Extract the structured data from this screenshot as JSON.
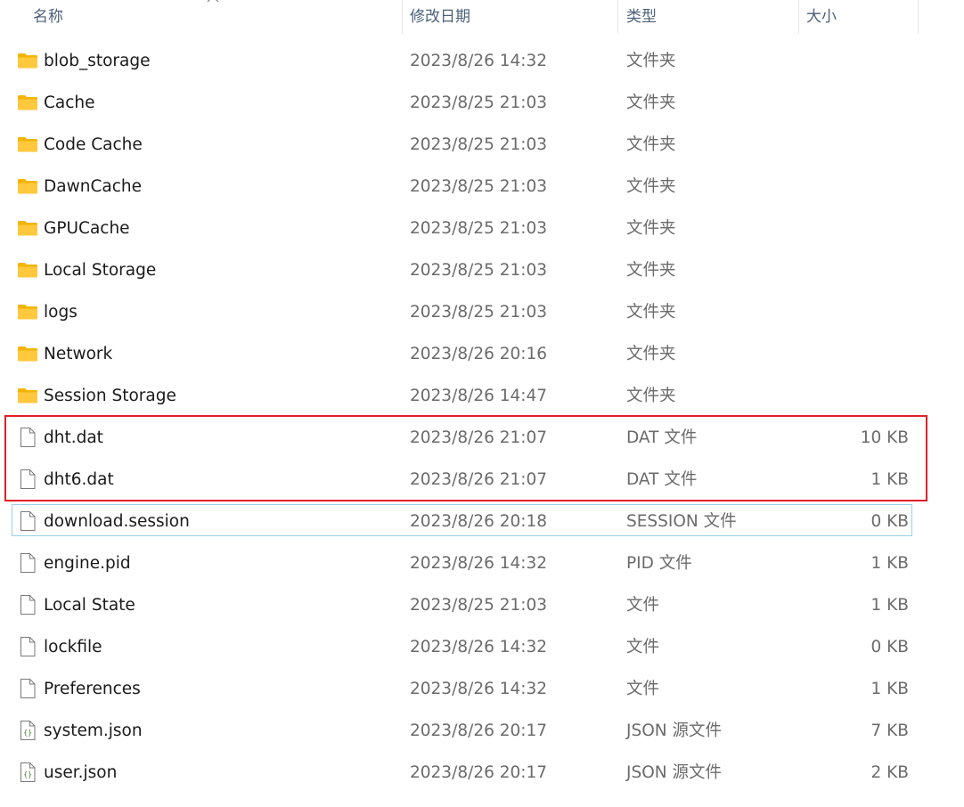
{
  "columns": {
    "name": "名称",
    "modified": "修改日期",
    "type": "类型",
    "size": "大小"
  },
  "files": [
    {
      "name": "blob_storage",
      "modified": "2023/8/26 14:32",
      "type": "文件夹",
      "size": "",
      "icon": "folder-icon"
    },
    {
      "name": "Cache",
      "modified": "2023/8/25 21:03",
      "type": "文件夹",
      "size": "",
      "icon": "folder-icon"
    },
    {
      "name": "Code Cache",
      "modified": "2023/8/25 21:03",
      "type": "文件夹",
      "size": "",
      "icon": "folder-icon"
    },
    {
      "name": "DawnCache",
      "modified": "2023/8/25 21:03",
      "type": "文件夹",
      "size": "",
      "icon": "folder-icon"
    },
    {
      "name": "GPUCache",
      "modified": "2023/8/25 21:03",
      "type": "文件夹",
      "size": "",
      "icon": "folder-icon"
    },
    {
      "name": "Local Storage",
      "modified": "2023/8/25 21:03",
      "type": "文件夹",
      "size": "",
      "icon": "folder-icon"
    },
    {
      "name": "logs",
      "modified": "2023/8/25 21:03",
      "type": "文件夹",
      "size": "",
      "icon": "folder-icon"
    },
    {
      "name": "Network",
      "modified": "2023/8/26 20:16",
      "type": "文件夹",
      "size": "",
      "icon": "folder-icon"
    },
    {
      "name": "Session Storage",
      "modified": "2023/8/26 14:47",
      "type": "文件夹",
      "size": "",
      "icon": "folder-icon"
    },
    {
      "name": "dht.dat",
      "modified": "2023/8/26 21:07",
      "type": "DAT 文件",
      "size": "10 KB",
      "icon": "file-icon"
    },
    {
      "name": "dht6.dat",
      "modified": "2023/8/26 21:07",
      "type": "DAT 文件",
      "size": "1 KB",
      "icon": "file-icon"
    },
    {
      "name": "download.session",
      "modified": "2023/8/26 20:18",
      "type": "SESSION 文件",
      "size": "0 KB",
      "icon": "file-icon"
    },
    {
      "name": "engine.pid",
      "modified": "2023/8/26 14:32",
      "type": "PID 文件",
      "size": "1 KB",
      "icon": "file-icon"
    },
    {
      "name": "Local State",
      "modified": "2023/8/25 21:03",
      "type": "文件",
      "size": "1 KB",
      "icon": "file-icon"
    },
    {
      "name": "lockfile",
      "modified": "2023/8/26 14:32",
      "type": "文件",
      "size": "0 KB",
      "icon": "file-icon"
    },
    {
      "name": "Preferences",
      "modified": "2023/8/26 14:32",
      "type": "文件",
      "size": "1 KB",
      "icon": "file-icon"
    },
    {
      "name": "system.json",
      "modified": "2023/8/26 20:17",
      "type": "JSON 源文件",
      "size": "7 KB",
      "icon": "json-file-icon"
    },
    {
      "name": "user.json",
      "modified": "2023/8/26 20:17",
      "type": "JSON 源文件",
      "size": "2 KB",
      "icon": "json-file-icon"
    }
  ],
  "colors": {
    "header_text": "#4c607a",
    "highlight_box": "#e0202a",
    "focus_border": "#99d1e6",
    "folder_yellow": "#ffc83d"
  }
}
